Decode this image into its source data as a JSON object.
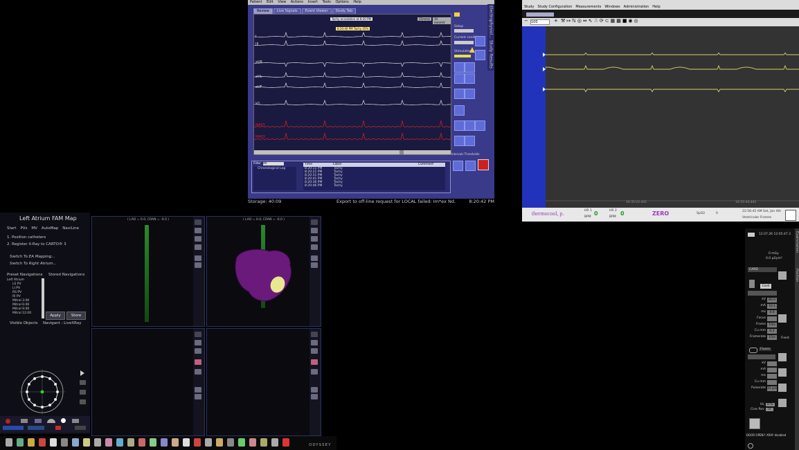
{
  "ep": {
    "menu": [
      "Patient",
      "Edit",
      "View",
      "Actions",
      "Insert",
      "Tools",
      "Options",
      "Help"
    ],
    "tabs": [
      "Review",
      "Live Signals",
      "Event Viewer",
      "Study Tab"
    ],
    "leads": [
      "I",
      "III",
      "aVR",
      "aVL",
      "aVF",
      "V1",
      "MAP1",
      "MAP2"
    ],
    "lead_colors": {
      "ecg": "#dcdcdc",
      "map": "#dd2020"
    },
    "annotation": "Tachy annotation at 8:20 PM",
    "annotation2": "8:20:40 PM  Tachy 45%",
    "sweep_label": "25mm/s",
    "gain_label": "10 mm/mV",
    "setup_label": "Setup",
    "current_condition_label": "Current condition",
    "stimulation_label": "Stimulation",
    "vtab_labels": [
      "Electrophysiol...",
      "Study Results"
    ],
    "stim_tabs": "Intervals  Thresholds",
    "log": {
      "filter_label": "Filter",
      "filter_value": "All",
      "tree_item": "Chronological Log",
      "columns": [
        "Time",
        "Label",
        "",
        "",
        "Comment"
      ],
      "rows": [
        [
          "8:20:11 PM",
          "Tachy"
        ],
        [
          "8:20:21 PM",
          "Tachy"
        ],
        [
          "8:20:31 PM",
          "Tachy"
        ],
        [
          "8:20:41 PM",
          "Tachy"
        ],
        [
          "8:20:36 PM",
          "Tachy"
        ],
        [
          "8:20:46 PM",
          "Tachy"
        ]
      ]
    },
    "status": {
      "storage": "Storage: 40:09",
      "export": "Export to off-line request for LOCAL failed: Im*ex Nd.",
      "time": "8:20:42 PM"
    }
  },
  "rec": {
    "menu": [
      "Study",
      "Study Configuration",
      "Measurements",
      "Windows",
      "Administration",
      "Help"
    ],
    "toolbar_value": "100",
    "time_ticks": [
      "16:35:22.441",
      "16:35:44.441"
    ],
    "bottom": {
      "catheter": "thermocool, p.",
      "readouts": [
        {
          "label": "HR 1",
          "value": "0",
          "sub": "BPM"
        },
        {
          "label": "HR 2",
          "value": "0",
          "sub": "BPM"
        }
      ],
      "zero_label": "ZERO",
      "misc": [
        "SpO2",
        "0"
      ],
      "datetime": "22:56:45 AM  Sat, Jan 4th",
      "right_text": "Ventricular  Frames"
    }
  },
  "nav": {
    "title": "Left Atrium FAM Map",
    "tabs": [
      "Start",
      "PVs",
      "MV",
      "AutoMap",
      "NaviLine"
    ],
    "steps": [
      "1.   Position catheters",
      "2.   Register X-Ray to CARTO® 3"
    ],
    "actions": [
      "Switch To EA Mapping...",
      "Switch To Right Atrium..."
    ],
    "preset_label": "Preset Navigations",
    "stored_label": "Stored Navigations",
    "preset_items": [
      "Left Atrium",
      "LS PV",
      "LI PV",
      "RS PV",
      "RI PV",
      "Mitral 3:00",
      "Mitral 6:00",
      "Mitral 9:00",
      "Mitral 12:00"
    ],
    "apply_label": "Apply",
    "store_label": "Store",
    "visible_objects": "Visible Objects",
    "navigant": "Navigant : LiveXRay",
    "view_headers": [
      "( LAO = 0.0, CRAN = -0.0 )",
      "( LAO = 0.0, CRAN = -0.0 )"
    ],
    "brand": "ODYSSEY"
  },
  "xr": {
    "header": "12.07.26 12:05:47.3",
    "dose_lines": [
      "0 mGy",
      "0.0 µGym²"
    ],
    "cam_label": "CARD",
    "card_btn": "Card",
    "fields": [
      [
        "kV",
        "80.0"
      ],
      [
        "mA",
        "10.1"
      ],
      [
        "ms",
        "4.0"
      ],
      [
        "Focus",
        ""
      ],
      [
        "Frame",
        "15/s"
      ],
      [
        "Cu mm",
        "0.2"
      ],
      [
        "Framerate",
        "15/s"
      ]
    ],
    "fixed_label": "Fixed",
    "fluoro_label": "Fluoro",
    "second_fields": [
      [
        "kV",
        ""
      ],
      [
        "mA",
        ""
      ],
      [
        "ms",
        ""
      ],
      [
        "Cu mm",
        ""
      ],
      [
        "Pulserate",
        "15 p/s"
      ]
    ],
    "hr_label": "HL",
    "hr_value": "0 %",
    "cine_label": "Cine Rev",
    "cine_value": "0",
    "door_text": "DOOR OPEN!! XRAY disabled",
    "vtabs": [
      "Examination",
      "Position"
    ]
  }
}
